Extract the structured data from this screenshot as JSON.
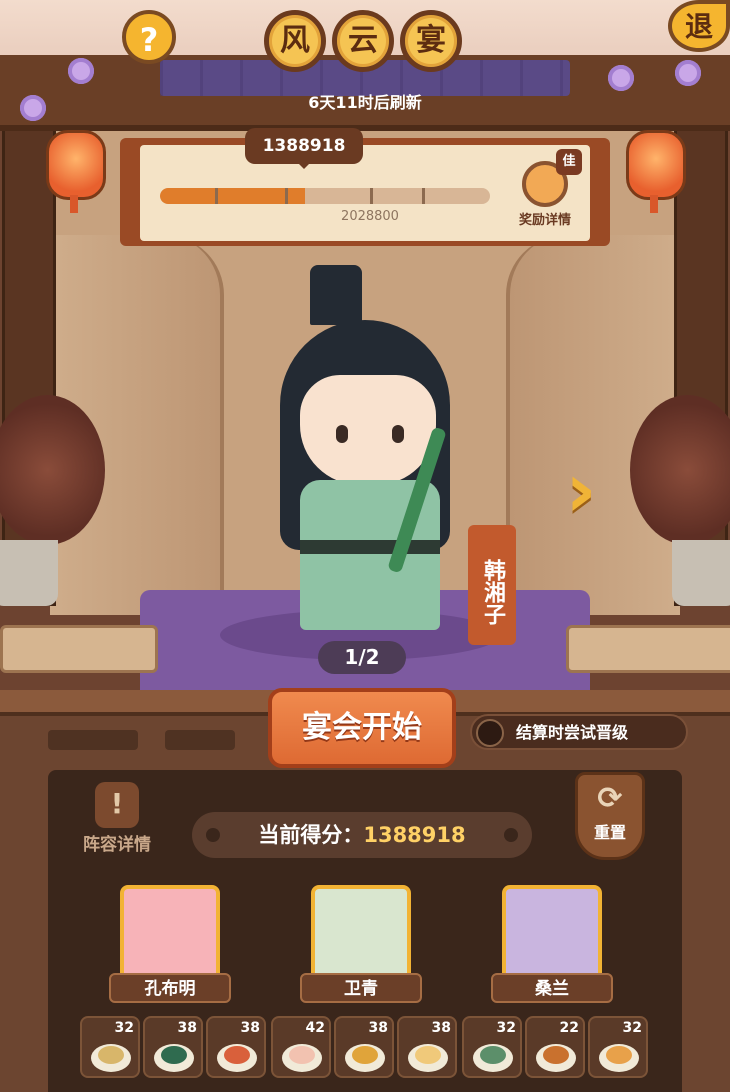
{
  "header": {
    "title_chars": [
      "风",
      "云",
      "宴"
    ],
    "help_label": "?",
    "exit_label": "退",
    "refresh_text": "6天11时后刷新"
  },
  "progress": {
    "current_score": "1388918",
    "target_score": "2028800",
    "fill_fraction": 0.44,
    "reward_badge": "佳",
    "reward_label": "奖励详情"
  },
  "character": {
    "name": "韩湘子",
    "page_indicator": "1/2",
    "next_arrow": "›"
  },
  "actions": {
    "start_label": "宴会开始",
    "upgrade_toggle_label": "结算时尝试晋级",
    "lineup_label": "阵容详情",
    "lineup_icon": "!",
    "reset_label": "重置",
    "reset_icon": "⟳"
  },
  "score": {
    "label": "当前得分：",
    "value": "1388918"
  },
  "heroes": [
    {
      "name": "孔布明",
      "color": "#f7b3b8"
    },
    {
      "name": "卫青",
      "color": "#d9e6cf"
    },
    {
      "name": "桑兰",
      "color": "#c9b5df"
    }
  ],
  "dishes": [
    {
      "count": "32",
      "color": "#d8b66a"
    },
    {
      "count": "38",
      "color": "#2f6b4f"
    },
    {
      "count": "38",
      "color": "#d9603b"
    },
    {
      "count": "42",
      "color": "#f2c2b0"
    },
    {
      "count": "38",
      "color": "#e0a43a"
    },
    {
      "count": "38",
      "color": "#f0c97a"
    },
    {
      "count": "32",
      "color": "#5c8f6a"
    },
    {
      "count": "22",
      "color": "#c9712e"
    },
    {
      "count": "32",
      "color": "#e8a14a"
    }
  ]
}
